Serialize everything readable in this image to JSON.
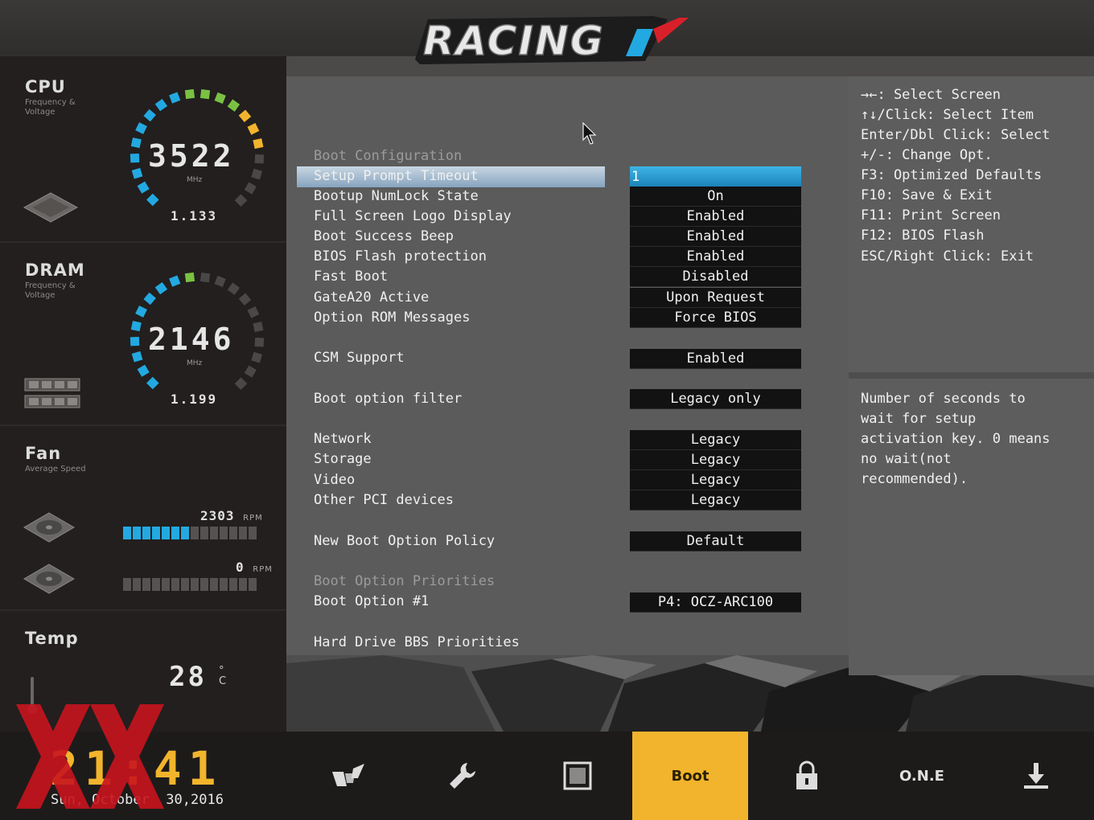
{
  "header": {
    "logo_text": "RACING"
  },
  "sidebar": {
    "cpu": {
      "title": "CPU",
      "subtitle": "Frequency & Voltage",
      "value": "3522",
      "unit": "MHz",
      "voltage": "1.133",
      "gauge_fraction": 0.78
    },
    "dram": {
      "title": "DRAM",
      "subtitle": "Frequency & Voltage",
      "value": "2146",
      "unit": "MHz",
      "voltage": "1.199",
      "gauge_fraction": 0.5
    },
    "fan": {
      "title": "Fan",
      "subtitle": "Average Speed",
      "fan1_rpm": "2303",
      "fan2_rpm": "0",
      "rpm_unit": "RPM",
      "fan1_fraction": 0.5,
      "fan2_fraction": 0
    },
    "temp": {
      "title": "Temp",
      "value": "28",
      "unit_deg": "°",
      "unit_c": "C"
    }
  },
  "boot_config": {
    "section_header": "Boot Configuration",
    "rows": [
      {
        "label": "Setup Prompt Timeout",
        "value": "1"
      },
      {
        "label": "Bootup NumLock State",
        "value": "On"
      },
      {
        "label": "Full Screen Logo Display",
        "value": "Enabled"
      },
      {
        "label": "Boot Success Beep",
        "value": "Enabled"
      },
      {
        "label": "BIOS Flash protection",
        "value": "Enabled"
      },
      {
        "label": "Fast Boot",
        "value": "Disabled"
      },
      {
        "label": "GateA20 Active",
        "value": "Upon Request"
      },
      {
        "label": "Option ROM Messages",
        "value": "Force BIOS"
      }
    ],
    "csm_support": {
      "label": "CSM Support",
      "value": "Enabled"
    },
    "boot_option_filter": {
      "label": "Boot option filter",
      "value": "Legacy only"
    },
    "oprom_rows": [
      {
        "label": "Network",
        "value": "Legacy"
      },
      {
        "label": "Storage",
        "value": "Legacy"
      },
      {
        "label": "Video",
        "value": "Legacy"
      },
      {
        "label": "Other PCI devices",
        "value": "Legacy"
      }
    ],
    "new_boot_option_policy": {
      "label": "New Boot Option Policy",
      "value": "Default"
    },
    "priorities_header": "Boot Option Priorities",
    "boot_option_1": {
      "label": "Boot Option #1",
      "value": "P4: OCZ-ARC100"
    },
    "hdd_bbs": "Hard Drive BBS Priorities"
  },
  "help": {
    "keys": [
      "→←: Select Screen",
      "↑↓/Click: Select Item",
      "Enter/Dbl Click: Select",
      "+/-: Change Opt.",
      "F3: Optimized Defaults",
      "F10: Save & Exit",
      "F11: Print Screen",
      "F12: BIOS Flash",
      "ESC/Right Click: Exit"
    ],
    "description": [
      "Number of seconds to",
      "wait for setup",
      "activation key. 0 means",
      "no wait(not",
      "recommended)."
    ]
  },
  "bottom": {
    "clock": "21:41",
    "date": "Sun, October  30,2016",
    "nav": [
      {
        "id": "oc",
        "label": "",
        "icon": "racing-logo-icon"
      },
      {
        "id": "advanced",
        "label": "",
        "icon": "wrench-icon"
      },
      {
        "id": "chipset",
        "label": "",
        "icon": "chip-icon"
      },
      {
        "id": "boot",
        "label": "Boot",
        "icon": ""
      },
      {
        "id": "security",
        "label": "",
        "icon": "lock-icon"
      },
      {
        "id": "one",
        "label": "O.N.E",
        "icon": ""
      },
      {
        "id": "exit",
        "label": "",
        "icon": "download-icon"
      }
    ]
  },
  "colors": {
    "accent_yellow": "#f2b42c",
    "accent_blue": "#23a9e1",
    "gauge_green": "#7ac143",
    "watermark_red": "#c8141e"
  }
}
